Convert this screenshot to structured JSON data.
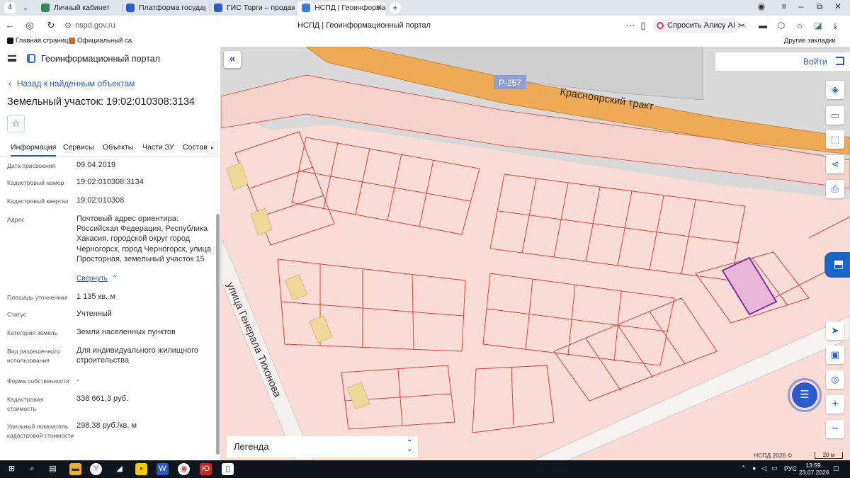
{
  "browser": {
    "tab_counter": "4",
    "tabs": [
      {
        "title": "Личный кабинет",
        "color": "#2e8b57"
      },
      {
        "title": "Платформа государстве",
        "color": "#2a5ccf"
      },
      {
        "title": "ГИС Торги – продажи гос",
        "color": "#2a5ccf"
      },
      {
        "title": "НСПД | Геоинформаци",
        "color": "#3a7be0"
      }
    ],
    "url": "nspd.gov.ru",
    "page_title": "НСПД | Геоинформационный портал",
    "alisa_label": "Спросить Алису AI",
    "bookmarks": [
      {
        "label": "Главная страница",
        "color": "#111"
      },
      {
        "label": "Официальный са",
        "color": "#e0652a"
      }
    ],
    "other_bookmarks": "Другие закладки"
  },
  "panel": {
    "portal_title": "Геоинформационный портал",
    "back_label": "Назад к найденным объектам",
    "object_title": "Земельный участок: 19:02:010308:3134",
    "tabs": [
      "Информация",
      "Сервисы",
      "Объекты",
      "Части ЗУ",
      "Состав"
    ],
    "fields": [
      {
        "label": "Дата присвоения",
        "value": "09.04.2019"
      },
      {
        "label": "Кадастровый номер",
        "value": "19:02:010308:3134"
      },
      {
        "label": "Кадастровый квартал",
        "value": "19:02:010308"
      },
      {
        "label": "Адрес",
        "value": "Почтовый адрес ориентира: Российская Федерация, Республика Хакасия, городской округ город Черногорск, город Черногорск, улица Просторная, земельный участок 15"
      },
      {
        "label": "Площадь уточненная",
        "value": "1 135 кв. м"
      },
      {
        "label": "Статус",
        "value": "Учтенный"
      },
      {
        "label": "Категория земель",
        "value": "Земли населенных пунктов"
      },
      {
        "label": "Вид разрешенного использования",
        "value": "Для индивидуального жилищного строительства"
      },
      {
        "label": "Форма собственности",
        "value": "-"
      },
      {
        "label": "Кадастровая стоимость",
        "value": "338 661,3 руб."
      },
      {
        "label": "Удельный показатель кадастровой стоимости",
        "value": "298,38 руб./кв. м"
      }
    ],
    "collapse_label": "Свернуть"
  },
  "map": {
    "road_badge": "Р-257",
    "road_name": "Красноярский тракт",
    "street_name": "улица Генерала Тихонова",
    "login_label": "Войти",
    "legend_label": "Легенда",
    "attribution": "НСПД 2026 ©",
    "scale_label": "20 м",
    "colors": {
      "parcel_fill": "#f9dcd6",
      "parcel_line": "#e0433a",
      "road": "#eeaa55",
      "selected_fill": "#e8b6d6",
      "selected_line": "#8a2aa0",
      "building": "#f0d89a"
    }
  },
  "taskbar": {
    "lang": "РУС",
    "time": "13:59",
    "date": "23.07.2026"
  }
}
